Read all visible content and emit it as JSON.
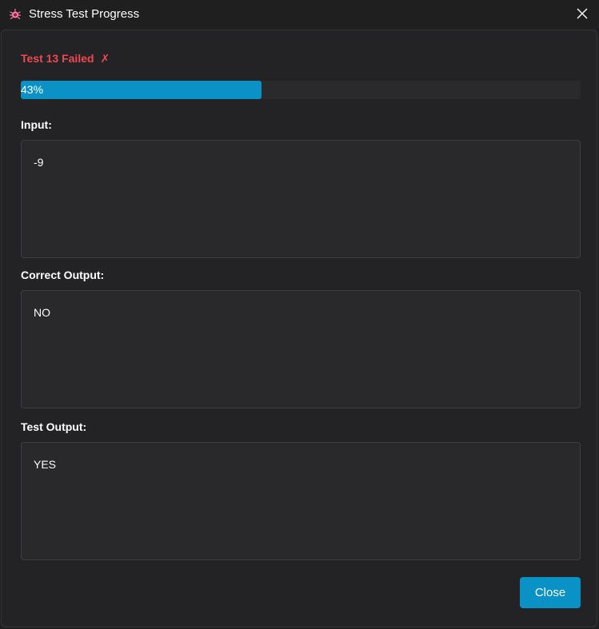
{
  "window": {
    "title": "Stress Test Progress",
    "icon": "bug-icon",
    "close_icon": "close-icon"
  },
  "status": {
    "text": "Test 13 Failed",
    "mark": "✗",
    "color": "#f0484f"
  },
  "progress": {
    "value": 0.43,
    "label": "43%",
    "fill_color": "#0a92c7"
  },
  "sections": {
    "input": {
      "label": "Input:",
      "value": "-9"
    },
    "correct_output": {
      "label": "Correct Output:",
      "value": "NO"
    },
    "test_output": {
      "label": "Test Output:",
      "value": "YES"
    }
  },
  "actions": {
    "close_label": "Close"
  },
  "colors": {
    "accent": "#0a92c7",
    "background": "#1f1f1f",
    "panel": "#232325",
    "error": "#f0484f"
  }
}
